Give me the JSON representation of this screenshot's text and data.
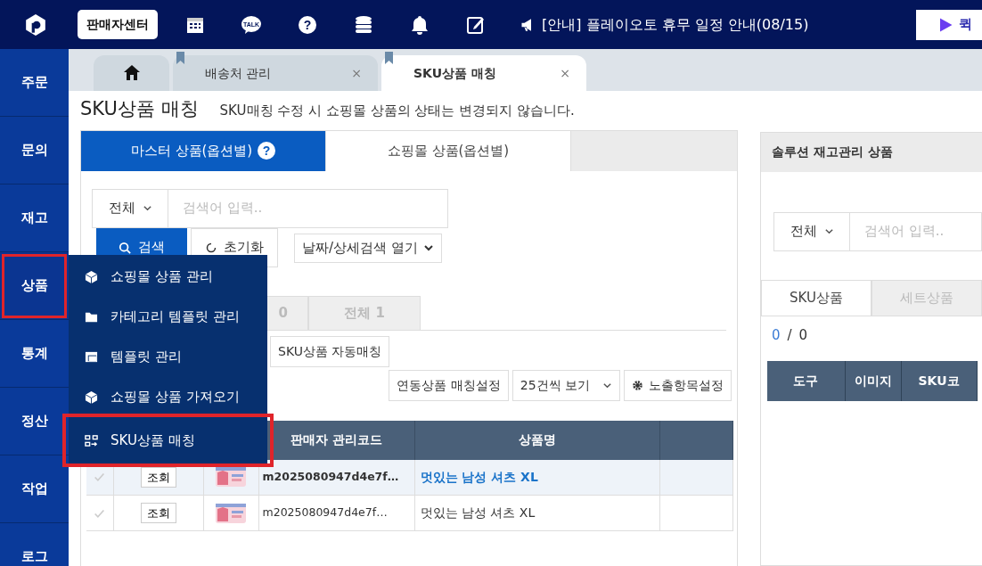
{
  "topbar": {
    "seller_center": "판매자센터",
    "talk_label": "TALK",
    "help_glyph": "?",
    "notice": "[안내] 플레이오토 휴무 일정 안내(08/15)",
    "quick_button": "퀵"
  },
  "sidebar": {
    "items": [
      {
        "label": "주문",
        "selected": false
      },
      {
        "label": "문의",
        "selected": false
      },
      {
        "label": "재고",
        "selected": false
      },
      {
        "label": "상품",
        "selected": true
      },
      {
        "label": "통계",
        "selected": false
      },
      {
        "label": "정산",
        "selected": false
      },
      {
        "label": "작업",
        "selected": false
      },
      {
        "label": "로그",
        "selected": false
      }
    ]
  },
  "flyout_menu": {
    "items": [
      {
        "label": "쇼핑몰 상품 관리",
        "kind": "cube",
        "selected": false
      },
      {
        "label": "카테고리 템플릿 관리",
        "kind": "folder",
        "selected": false
      },
      {
        "label": "템플릿 관리",
        "kind": "template",
        "selected": false
      },
      {
        "label": "쇼핑몰 상품 가져오기",
        "kind": "cube",
        "selected": false
      },
      {
        "label": "SKU상품 매칭",
        "kind": "match",
        "selected": true
      }
    ]
  },
  "page_tabs": [
    {
      "kind": "home",
      "selected": false
    },
    {
      "kind": "page",
      "label": "배송처 관리",
      "selected": false,
      "close": "×"
    },
    {
      "kind": "page",
      "label": "SKU상품 매칭",
      "selected": true,
      "close": "×"
    }
  ],
  "page_title": "SKU상품 매칭",
  "page_note": "SKU매칭 수정 시 쇼핑몰 상품의 상태는 변경되지 않습니다.",
  "master_panel": {
    "tabs": [
      {
        "label": "마스터 상품(옵션별)",
        "selected": true,
        "help": "?"
      },
      {
        "label": "쇼핑몰 상품(옵션별)",
        "selected": false
      }
    ],
    "search": {
      "scope": "전체",
      "placeholder": "검색어 입력.."
    },
    "search_button": "검색",
    "reset_button": "초기화",
    "detail_toggle": "날짜/상세검색 열기",
    "filter_tabs": [
      "0",
      "전체 1"
    ],
    "auto_match_button": "SKU상품 자동매칭",
    "toolbar": [
      {
        "kind": "plain",
        "label": "연동상품 매칭설정"
      },
      {
        "kind": "dropdown",
        "label": "25건씩 보기"
      },
      {
        "kind": "settings",
        "label": "노출항목설정"
      }
    ],
    "table": {
      "columns": [
        "판매자 관리코드",
        "상품명"
      ],
      "rows": [
        {
          "view": "조회",
          "code": "m2025080947d4e7f…",
          "name": "멋있는 남성 셔츠 XL",
          "selected": true
        },
        {
          "view": "조회",
          "code": "m2025080947d4e7f…",
          "name": "멋있는 남성 셔츠 XL",
          "selected": false
        }
      ]
    }
  },
  "solution_panel": {
    "title": "솔루션 재고관리 상품",
    "search": {
      "scope": "전체",
      "placeholder": "검색어 입력.."
    },
    "tabs": [
      {
        "label": "SKU상품",
        "selected": true
      },
      {
        "label": "세트상품",
        "selected": false
      }
    ],
    "count": {
      "selected": "0",
      "separator": "/",
      "total": "0"
    },
    "table": {
      "columns": [
        "도구",
        "이미지",
        "SKU코"
      ]
    }
  }
}
